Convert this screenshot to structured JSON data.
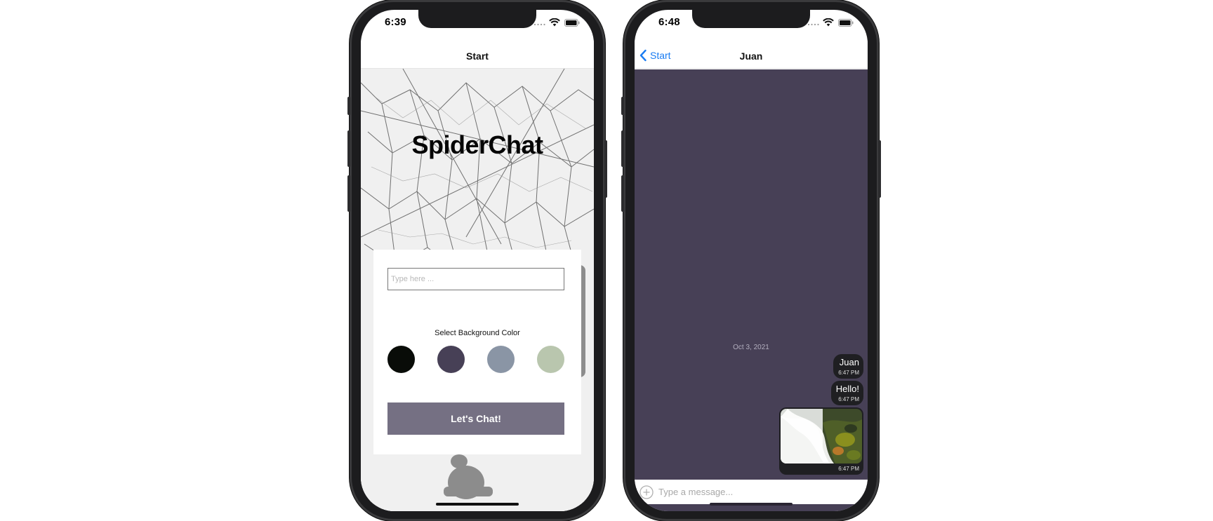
{
  "start_screen": {
    "status_time": "6:39",
    "nav_title": "Start",
    "app_title": "SpiderChat",
    "name_input": {
      "value": "",
      "placeholder": "Type here ..."
    },
    "color_label": "Select Background Color",
    "colors": [
      "#090c08",
      "#474056",
      "#8a95a5",
      "#b9c6ae"
    ],
    "chat_button_label": "Let's Chat!",
    "chat_button_color": "#757083"
  },
  "chat_screen": {
    "status_time": "6:48",
    "back_label": "Start",
    "nav_title": "Juan",
    "background_color": "#474056",
    "date_label": "Oct 3, 2021",
    "messages": [
      {
        "text": "Juan",
        "time": "6:47 PM"
      },
      {
        "text": "Hello!",
        "time": "6:47 PM"
      },
      {
        "image": "waterfall-photo",
        "time": "6:47 PM"
      }
    ],
    "composer": {
      "value": "",
      "placeholder": "Type a message..."
    }
  },
  "icons": {
    "signal": "signal-icon",
    "wifi": "wifi-icon",
    "battery": "battery-icon",
    "back": "chevron-left-icon",
    "attach": "plus-circle-icon"
  }
}
